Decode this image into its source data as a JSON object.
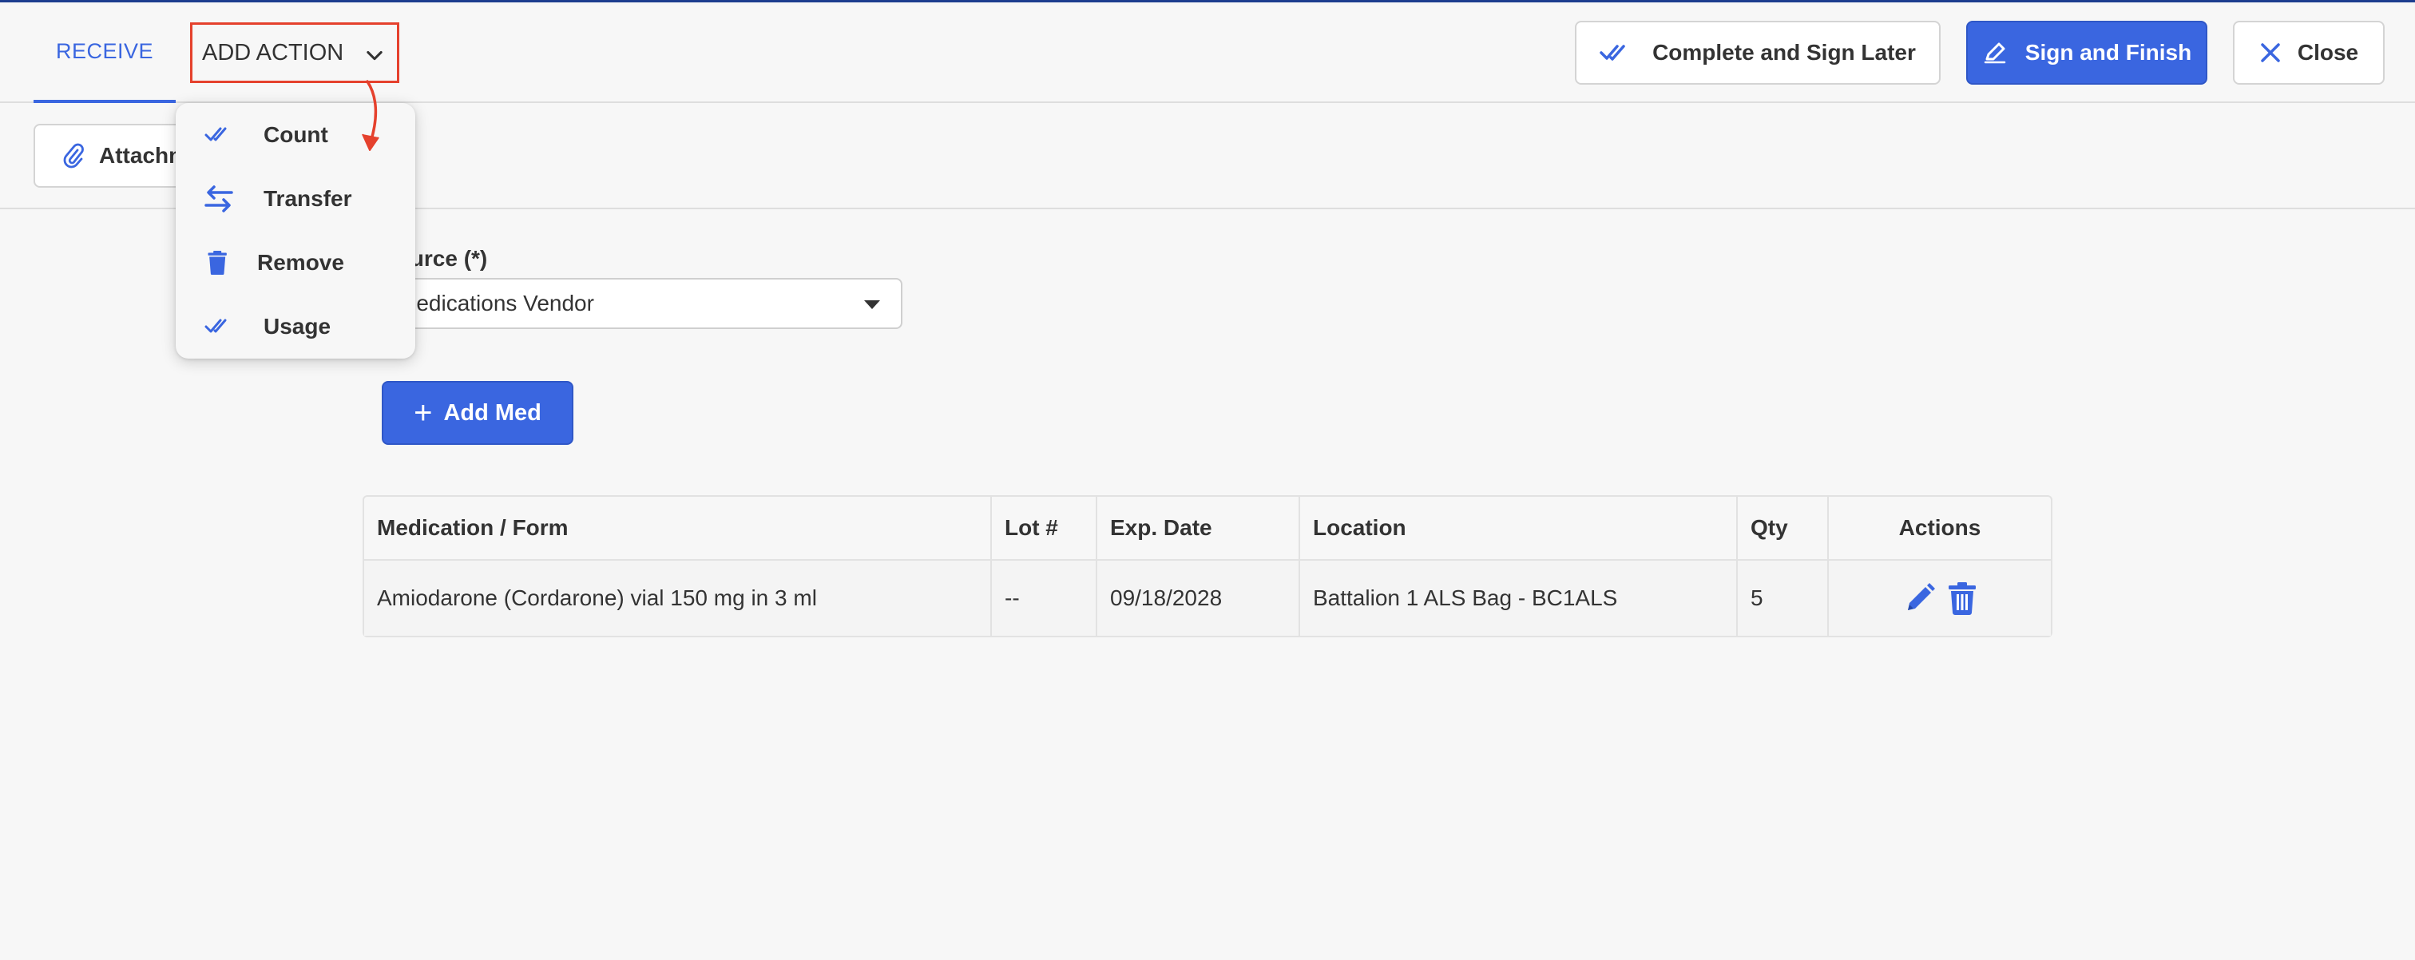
{
  "header": {
    "tab_receive": "RECEIVE",
    "add_action_label": "ADD ACTION",
    "complete_sign_later": "Complete and Sign Later",
    "sign_and_finish": "Sign and Finish",
    "close": "Close"
  },
  "subbar": {
    "attach_label": "Attachments"
  },
  "form": {
    "source_label": "Source (*)",
    "source_value": "Medications Vendor",
    "add_med": "Add Med"
  },
  "dropdown": {
    "items": [
      {
        "label": "Count",
        "icon": "double-check-icon"
      },
      {
        "label": "Transfer",
        "icon": "transfer-arrows-icon"
      },
      {
        "label": "Remove",
        "icon": "trash-icon"
      },
      {
        "label": "Usage",
        "icon": "double-check-icon"
      }
    ]
  },
  "table": {
    "headers": [
      "Medication / Form",
      "Lot #",
      "Exp. Date",
      "Location",
      "Qty",
      "Actions"
    ],
    "rows": [
      {
        "medication": "Amiodarone (Cordarone) vial 150 mg in 3 ml",
        "lot": "--",
        "exp_date": "09/18/2028",
        "location": "Battalion 1 ALS Bag - BC1ALS",
        "qty": "5",
        "actions": [
          "pencil-icon",
          "trash-icon"
        ]
      }
    ]
  },
  "colors": {
    "primary": "#3a66e0",
    "highlight": "#e5412d",
    "background": "#f7f7f7"
  }
}
